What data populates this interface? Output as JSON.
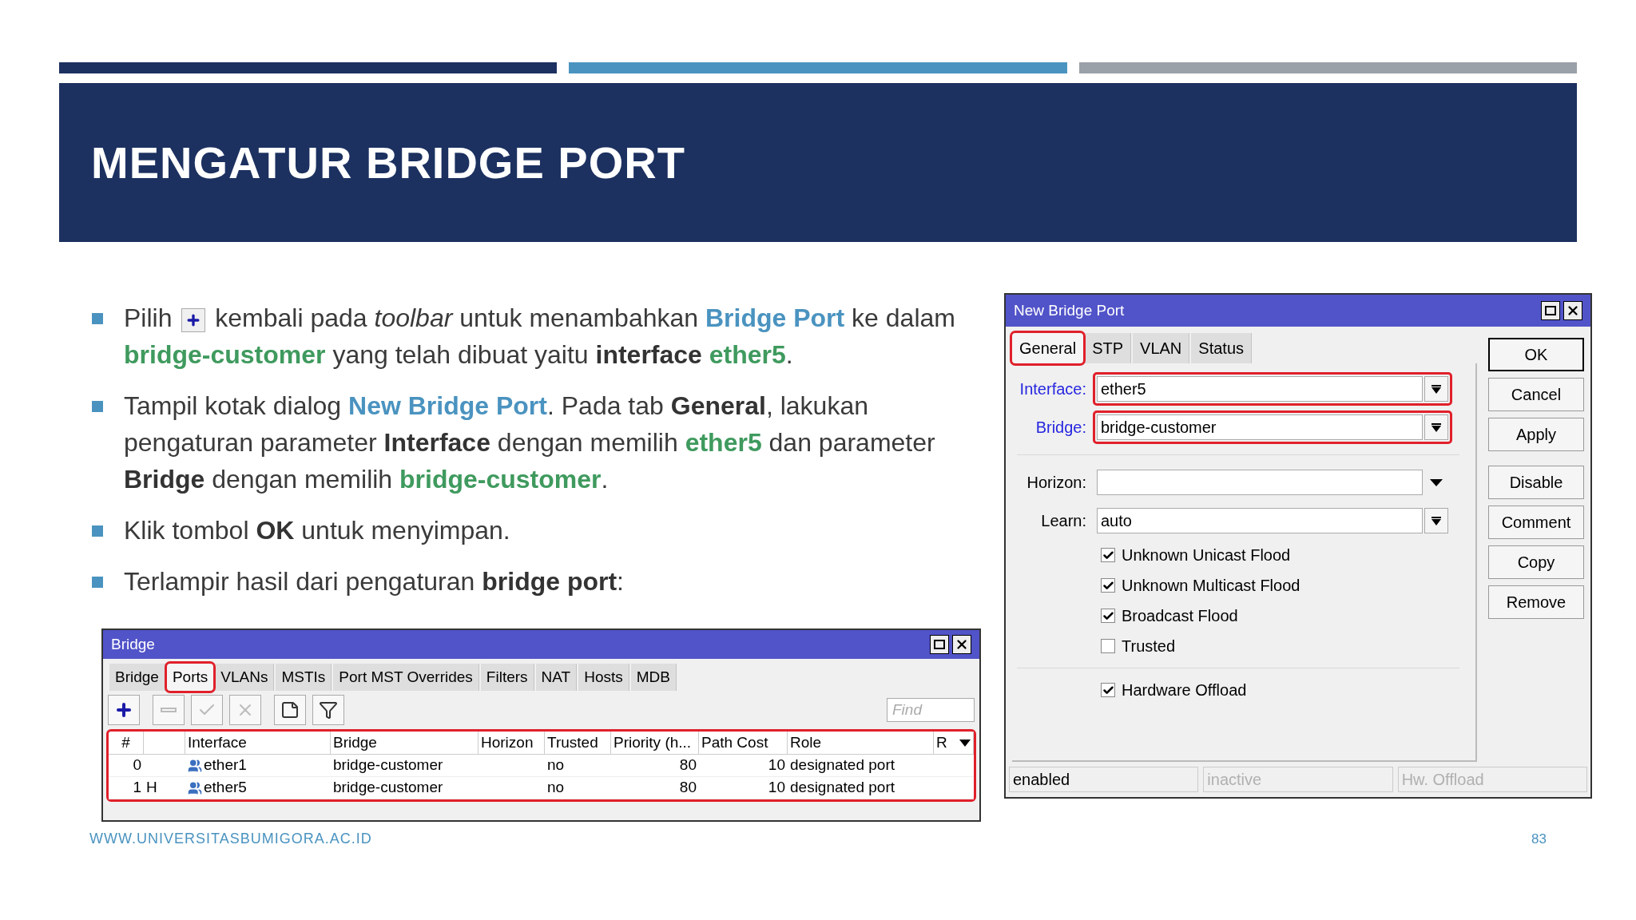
{
  "slide": {
    "title": "MENGATUR BRIDGE PORT"
  },
  "bullets": [
    {
      "segments": [
        {
          "kind": "text",
          "text": "Pilih "
        },
        {
          "kind": "icon"
        },
        {
          "kind": "text",
          "text": " kembali pada "
        },
        {
          "kind": "italic",
          "text": "toolbar"
        },
        {
          "kind": "text",
          "text": " untuk menambahkan "
        },
        {
          "kind": "blue",
          "text": "Bridge Port"
        },
        {
          "kind": "text",
          "text": " ke dalam "
        },
        {
          "kind": "green",
          "text": "bridge-customer"
        },
        {
          "kind": "text",
          "text": " yang telah dibuat yaitu "
        },
        {
          "kind": "bold",
          "text": "interface "
        },
        {
          "kind": "green",
          "text": "ether5"
        },
        {
          "kind": "text",
          "text": "."
        }
      ]
    },
    {
      "segments": [
        {
          "kind": "text",
          "text": "Tampil kotak dialog "
        },
        {
          "kind": "blue",
          "text": "New Bridge Port"
        },
        {
          "kind": "text",
          "text": ". Pada tab "
        },
        {
          "kind": "bold",
          "text": "General"
        },
        {
          "kind": "text",
          "text": ", lakukan pengaturan parameter "
        },
        {
          "kind": "bold",
          "text": "Interface"
        },
        {
          "kind": "text",
          "text": " dengan memilih "
        },
        {
          "kind": "green",
          "text": "ether5"
        },
        {
          "kind": "text",
          "text": " dan parameter "
        },
        {
          "kind": "bold",
          "text": "Bridge"
        },
        {
          "kind": "text",
          "text": " dengan memilih "
        },
        {
          "kind": "green",
          "text": "bridge-customer"
        },
        {
          "kind": "text",
          "text": "."
        }
      ]
    },
    {
      "segments": [
        {
          "kind": "text",
          "text": "Klik tombol "
        },
        {
          "kind": "bold",
          "text": "OK"
        },
        {
          "kind": "text",
          "text": " untuk menyimpan."
        }
      ]
    },
    {
      "segments": [
        {
          "kind": "text",
          "text": "Terlampir hasil dari pengaturan "
        },
        {
          "kind": "bold",
          "text": "bridge port"
        },
        {
          "kind": "text",
          "text": ":"
        }
      ]
    }
  ],
  "bridge_window": {
    "title": "Bridge",
    "tabs": [
      {
        "label": "Bridge",
        "selected": false,
        "highlighted": false
      },
      {
        "label": "Ports",
        "selected": true,
        "highlighted": true
      },
      {
        "label": "VLANs",
        "selected": false,
        "highlighted": false
      },
      {
        "label": "MSTIs",
        "selected": false,
        "highlighted": false
      },
      {
        "label": "Port MST Overrides",
        "selected": false,
        "highlighted": false
      },
      {
        "label": "Filters",
        "selected": false,
        "highlighted": false
      },
      {
        "label": "NAT",
        "selected": false,
        "highlighted": false
      },
      {
        "label": "Hosts",
        "selected": false,
        "highlighted": false
      },
      {
        "label": "MDB",
        "selected": false,
        "highlighted": false
      }
    ],
    "toolbar": [
      {
        "kind": "add",
        "disabled": false
      },
      {
        "kind": "remove",
        "disabled": true
      },
      {
        "kind": "enable",
        "disabled": true
      },
      {
        "kind": "disable",
        "disabled": true
      },
      {
        "kind": "comment",
        "disabled": false
      },
      {
        "kind": "filter",
        "disabled": false
      }
    ],
    "search": {
      "placeholder": "Find"
    },
    "table": {
      "highlighted": true,
      "columns": [
        {
          "label": "#",
          "kind": "number"
        },
        {
          "kind": "flag"
        },
        {
          "label": "Interface",
          "kind": "interface"
        },
        {
          "label": "Bridge",
          "kind": "text"
        },
        {
          "label": "Horizon",
          "kind": "text"
        },
        {
          "label": "Trusted",
          "kind": "text"
        },
        {
          "label": "Priority (h...",
          "kind": "number"
        },
        {
          "label": "Path Cost",
          "kind": "number"
        },
        {
          "label": "Role",
          "kind": "text"
        },
        {
          "label": "R",
          "kind": "text"
        }
      ],
      "rows": [
        [
          "0",
          null,
          "ether1",
          "bridge-customer",
          null,
          "no",
          "80",
          "10",
          "designated port",
          null
        ],
        [
          "1",
          "H",
          "ether5",
          "bridge-customer",
          null,
          "no",
          "80",
          "10",
          "designated port",
          null
        ]
      ]
    }
  },
  "dialog": {
    "title": "New Bridge Port",
    "tabs": [
      {
        "label": "General",
        "selected": true,
        "highlighted": true
      },
      {
        "label": "STP",
        "selected": false,
        "highlighted": false
      },
      {
        "label": "VLAN",
        "selected": false,
        "highlighted": false
      },
      {
        "label": "Status",
        "selected": false,
        "highlighted": false
      }
    ],
    "field_groups": [
      [
        {
          "label": "Interface:",
          "value": "ether5",
          "kind": "combo",
          "required": true,
          "highlighted": true
        },
        {
          "label": "Bridge:",
          "value": "bridge-customer",
          "kind": "combo",
          "required": true,
          "highlighted": true
        }
      ],
      [
        {
          "label": "Horizon:",
          "kind": "list",
          "required": false,
          "highlighted": false
        },
        {
          "label": "Learn:",
          "value": "auto",
          "kind": "combo",
          "required": false,
          "highlighted": false
        }
      ]
    ],
    "option_groups": [
      [
        {
          "label": "Unknown Unicast Flood",
          "checked": true
        },
        {
          "label": "Unknown Multicast Flood",
          "checked": true
        },
        {
          "label": "Broadcast Flood",
          "checked": true
        },
        {
          "label": "Trusted",
          "checked": false
        }
      ],
      [
        {
          "label": "Hardware Offload",
          "checked": true
        }
      ]
    ],
    "button_groups": [
      [
        {
          "label": "OK",
          "default": true
        },
        {
          "label": "Cancel",
          "default": false
        },
        {
          "label": "Apply",
          "default": false
        }
      ],
      [
        {
          "label": "Disable",
          "default": false
        },
        {
          "label": "Comment",
          "default": false
        },
        {
          "label": "Copy",
          "default": false
        },
        {
          "label": "Remove",
          "default": false
        }
      ]
    ],
    "status_bar": [
      {
        "text": "enabled",
        "disabled": false
      },
      {
        "text": "inactive",
        "disabled": true
      },
      {
        "text": "Hw. Offload",
        "disabled": true
      }
    ]
  },
  "footer": {
    "url": "WWW.UNIVERSITASBUMIGORA.AC.ID",
    "page": "83"
  }
}
